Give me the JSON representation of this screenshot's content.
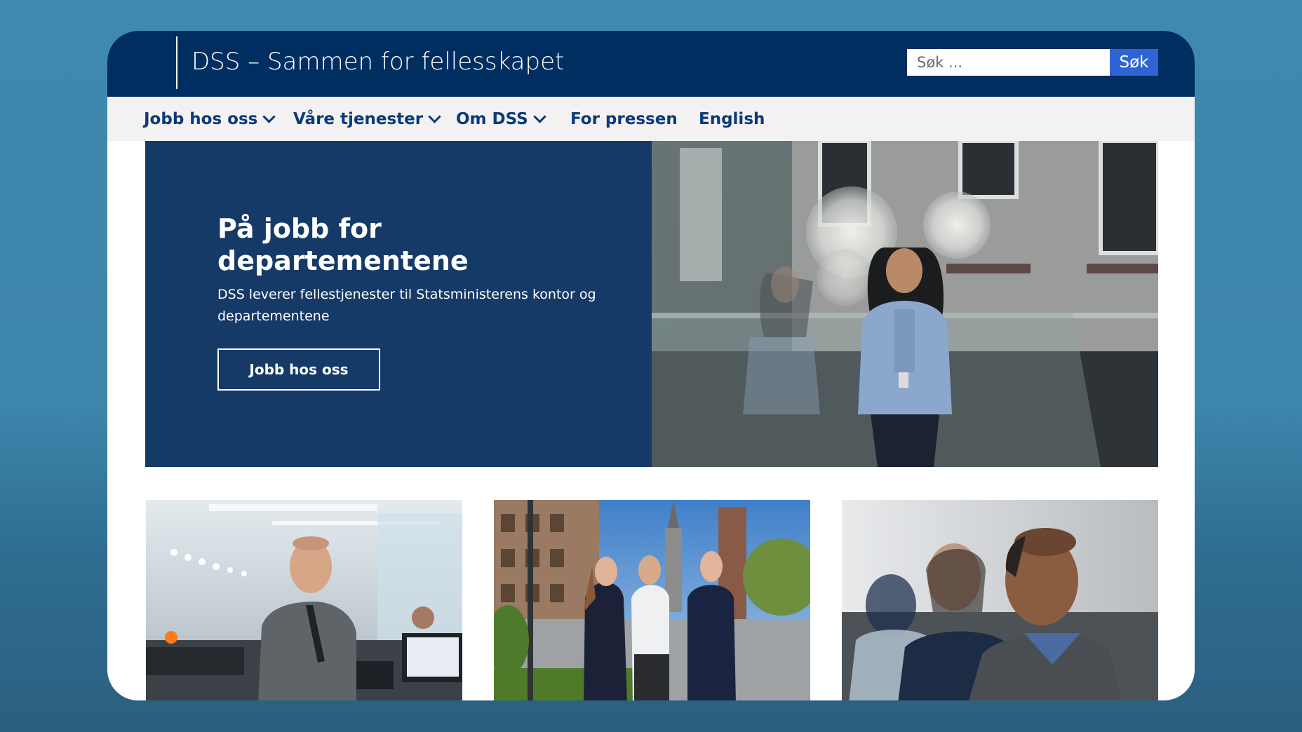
{
  "header": {
    "site_title": "DSS – Sammen for fellesskapet",
    "search_placeholder": "Søk ...",
    "search_button_label": "Søk"
  },
  "nav": {
    "items": [
      {
        "label": "Jobb hos oss",
        "has_dropdown": true
      },
      {
        "label": "Våre tjenester",
        "has_dropdown": true
      },
      {
        "label": "Om DSS",
        "has_dropdown": true
      },
      {
        "label": "For pressen",
        "has_dropdown": false
      },
      {
        "label": "English",
        "has_dropdown": false
      }
    ]
  },
  "hero": {
    "title": "På jobb for departementene",
    "text": "DSS leverer fellestjenester til Statsministerens kontor og departementene",
    "button_label": "Jobb hos oss"
  },
  "colors": {
    "header_bg": "#002e61",
    "nav_bg": "#f3f1f1",
    "nav_text": "#0b3a78",
    "hero_panel_bg": "#163a67",
    "search_button_bg": "#2e64d3",
    "page_bg": "#3f88ae"
  },
  "cards": [
    {
      "image": "office-worker-photo"
    },
    {
      "image": "security-staff-photo"
    },
    {
      "image": "smiling-man-photo"
    }
  ]
}
